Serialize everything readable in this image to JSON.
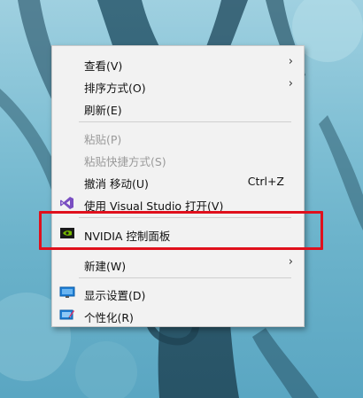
{
  "menu": {
    "items": [
      {
        "label": "查看(V)",
        "submenu": true
      },
      {
        "label": "排序方式(O)",
        "submenu": true
      },
      {
        "label": "刷新(E)"
      },
      {
        "label": "粘贴(P)",
        "disabled": true
      },
      {
        "label": "粘贴快捷方式(S)",
        "disabled": true
      },
      {
        "label": "撤消 移动(U)",
        "shortcut": "Ctrl+Z"
      },
      {
        "label": "使用 Visual Studio 打开(V)",
        "icon": "visual-studio-icon"
      },
      {
        "label": "NVIDIA 控制面板",
        "icon": "nvidia-icon"
      },
      {
        "label": "新建(W)",
        "submenu": true
      },
      {
        "label": "显示设置(D)",
        "icon": "display-settings-icon"
      },
      {
        "label": "个性化(R)",
        "icon": "personalize-icon"
      }
    ],
    "submenu_arrow": "›"
  },
  "colors": {
    "menu_background": "#f2f2f2",
    "highlight_box": "#e0101c",
    "disabled_text": "#9a9a9a",
    "visual_studio": "#7a4fc2",
    "nvidia": "#76b900",
    "display_settings": "#1e7fd6"
  }
}
